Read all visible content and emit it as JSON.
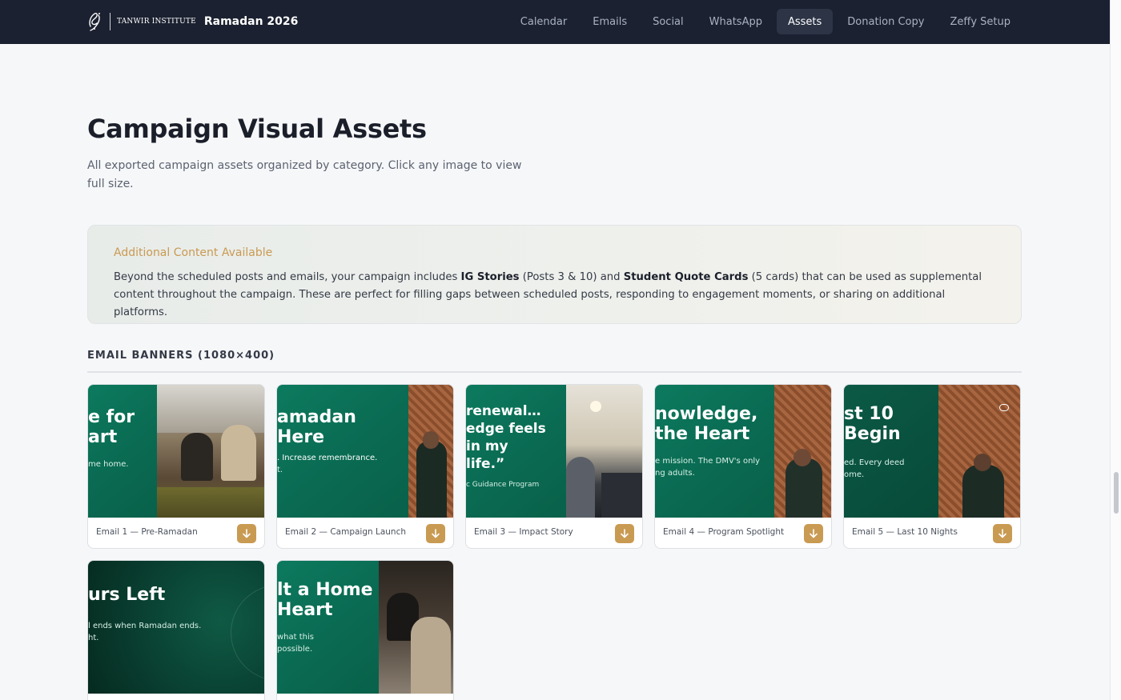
{
  "nav": {
    "institute": "TANWIR INSTITUTE",
    "title": "Ramadan 2026",
    "links": [
      {
        "label": "Calendar"
      },
      {
        "label": "Emails"
      },
      {
        "label": "Social"
      },
      {
        "label": "WhatsApp"
      },
      {
        "label": "Assets"
      },
      {
        "label": "Donation Copy"
      },
      {
        "label": "Zeffy Setup"
      }
    ],
    "active": "Assets"
  },
  "header": {
    "title": "Campaign Visual Assets",
    "subtitle": "All exported campaign assets organized by category. Click any image to view full size."
  },
  "callout": {
    "title": "Additional Content Available",
    "text_1": "Beyond the scheduled posts and emails, your campaign includes ",
    "bold_1": "IG Stories",
    "text_2": " (Posts 3 & 10) and ",
    "bold_2": "Student Quote Cards",
    "text_3": " (5 cards) that can be used as supplemental content throughout the campaign. These are perfect for filling gaps between scheduled posts, responding to engagement moments, or sharing on additional platforms."
  },
  "section": {
    "title": "EMAIL BANNERS (1080×400)"
  },
  "cards": [
    {
      "caption": "Email 1 — Pre-Ramadan",
      "headline_1": "e for",
      "headline_2": "art",
      "subline_1": "me home.",
      "subline_2": ""
    },
    {
      "caption": "Email 2 — Campaign Launch",
      "headline_1": "amadan",
      "headline_2": "Here",
      "subline_1": ". Increase remembrance.",
      "subline_2": "t."
    },
    {
      "caption": "Email 3 — Impact Story",
      "headline_1": " renewal…",
      "headline_2": "edge feels",
      "headline_3": "in my",
      "headline_4": "life.”",
      "subline_1": "c Guidance Program"
    },
    {
      "caption": "Email 4 — Program Spotlight",
      "headline_1": "nowledge,",
      "headline_2": " the Heart",
      "subline_1": "e mission. The DMV's only",
      "subline_2": "ng adults."
    },
    {
      "caption": "Email 5 — Last 10 Nights",
      "headline_1": "st 10",
      "headline_2": "Begin",
      "subline_1": "ed. Every deed",
      "subline_2": "ome."
    },
    {
      "caption": "",
      "headline_1": "urs Left",
      "subline_1": "l ends when Ramadan ends.",
      "subline_2": "ht."
    },
    {
      "caption": "",
      "headline_1": "lt a Home",
      "headline_2": "Heart",
      "subline_1": " what this",
      "subline_2": "possible."
    }
  ],
  "icons": {
    "download": "download-arrow-icon",
    "logo": "calligraphy-logo-icon"
  },
  "colors": {
    "nav_bg": "#1b2130",
    "accent_gold": "#c99a52",
    "banner_green": "#0a6a52",
    "dark_green": "#0b3b2e"
  }
}
